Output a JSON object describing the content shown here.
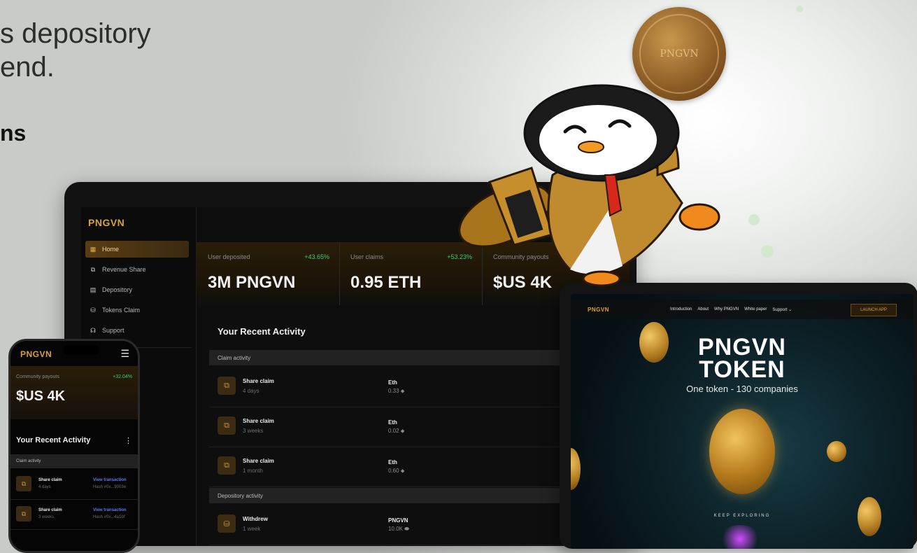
{
  "hero": {
    "line1": "s depository",
    "line2": "end.",
    "bold": "ns"
  },
  "colors": {
    "gold": "#d9a23a",
    "positive": "#3fcf6c",
    "link": "#5b7cf2",
    "dark": "#0e0e0e"
  },
  "laptop": {
    "brand": "PNGVN",
    "nav": [
      {
        "label": "Home",
        "icon": "grid-icon"
      },
      {
        "label": "Revenue Share",
        "icon": "share-icon"
      },
      {
        "label": "Depository",
        "icon": "vault-icon"
      },
      {
        "label": "Tokens Claim",
        "icon": "coins-icon"
      },
      {
        "label": "Support",
        "icon": "headset-icon"
      }
    ],
    "stats": [
      {
        "label": "User deposited",
        "change": "+43.65%",
        "value": "3M PNGVN"
      },
      {
        "label": "User claims",
        "change": "+53.23%",
        "value": "0.95 ETH"
      },
      {
        "label": "Community payouts",
        "change": "",
        "value": "$US 4K"
      }
    ],
    "activity_title": "Your Recent Activity",
    "claim_section": "Claim activity",
    "claims": [
      {
        "name": "Share claim",
        "time": "4 days",
        "currency": "Eth",
        "amount": "0.33 ⬥"
      },
      {
        "name": "Share claim",
        "time": "3 weeks",
        "currency": "Eth",
        "amount": "0.02 ⬥"
      },
      {
        "name": "Share claim",
        "time": "1 month",
        "currency": "Eth",
        "amount": "0.60 ⬥"
      }
    ],
    "deposit_section": "Depository activity",
    "deposits": [
      {
        "name": "Withdrew",
        "time": "1 week",
        "currency": "PNGVN",
        "amount": "10.0K ⬬"
      }
    ]
  },
  "phone": {
    "brand": "PNGVN",
    "stat": {
      "label": "Community payouts",
      "change": "+32.04%",
      "value": "$US 4K"
    },
    "activity_title": "Your Recent Activity",
    "section": "Claim activity",
    "rows": [
      {
        "name": "Share claim",
        "time": "4 days",
        "link": "View transaction",
        "hash": "Hash #0x...9003e"
      },
      {
        "name": "Share claim",
        "time": "3 weeks",
        "link": "View transaction",
        "hash": "Hash #0x...4a1bf"
      }
    ]
  },
  "tablet": {
    "brand": "PNGVN",
    "links": [
      "Introduction",
      "About",
      "Why PNGVN",
      "White paper",
      "Support ⌄"
    ],
    "launch": "LAUNCH APP",
    "title_line1": "PNGVN",
    "title_line2": "TOKEN",
    "subtitle": "One token - 130 companies",
    "explore": "KEEP EXPLORING"
  },
  "coin": {
    "text": "PNGVN"
  }
}
